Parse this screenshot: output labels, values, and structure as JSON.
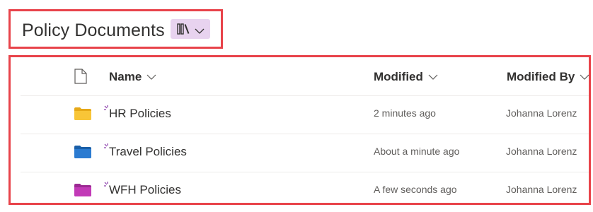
{
  "header": {
    "title": "Policy Documents",
    "view_switcher": {
      "icon": "library-icon",
      "dropdown_icon": "chevron-down-icon",
      "background": "#e8d3ef"
    }
  },
  "table": {
    "columns": [
      {
        "key": "type",
        "label": "",
        "icon": "document-icon"
      },
      {
        "key": "name",
        "label": "Name",
        "sortable": true
      },
      {
        "key": "modified",
        "label": "Modified",
        "sortable": true
      },
      {
        "key": "modified_by",
        "label": "Modified By",
        "sortable": true
      }
    ],
    "rows": [
      {
        "icon": "folder-icon",
        "color": "#f8c537",
        "is_new": true,
        "name": "HR Policies",
        "modified": "2 minutes ago",
        "modified_by": "Johanna Lorenz"
      },
      {
        "icon": "folder-icon",
        "color": "#2b7bd1",
        "is_new": true,
        "name": "Travel Policies",
        "modified": "About a minute ago",
        "modified_by": "Johanna Lorenz"
      },
      {
        "icon": "folder-icon",
        "color": "#c23ab7",
        "is_new": true,
        "name": "WFH Policies",
        "modified": "A few seconds ago",
        "modified_by": "Johanna Lorenz"
      }
    ]
  },
  "colors": {
    "highlight_border": "#e8434a",
    "new_indicator": "#8a3bab",
    "divider": "#edebe9"
  }
}
